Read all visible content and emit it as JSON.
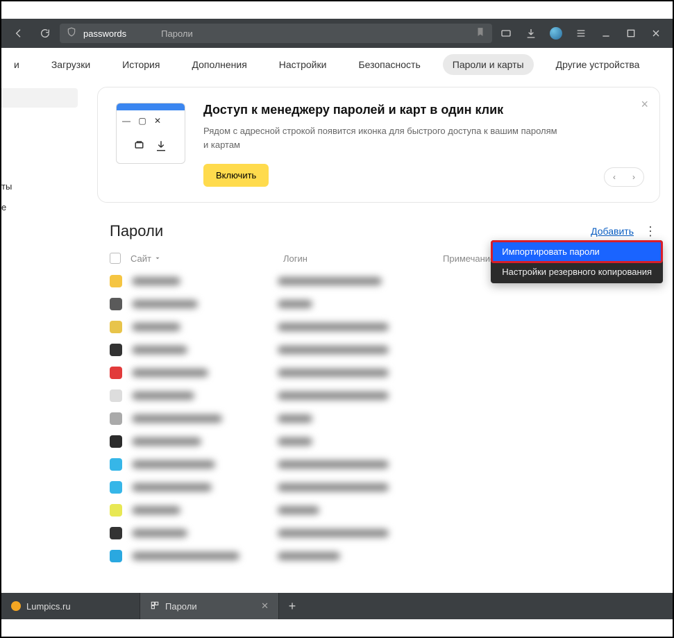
{
  "chrome": {
    "url_text": "passwords",
    "url_title": "Пароли"
  },
  "nav": {
    "items": [
      "и",
      "Загрузки",
      "История",
      "Дополнения",
      "Настройки",
      "Безопасность",
      "Пароли и карты",
      "Другие устройства"
    ],
    "active_index": 6
  },
  "sidebar": {
    "items": [
      "ты",
      "е"
    ]
  },
  "promo": {
    "title": "Доступ к менеджеру паролей и карт в один клик",
    "text": "Рядом с адресной строкой появится иконка для быстрого доступа к вашим паролям и картам",
    "button": "Включить"
  },
  "section": {
    "title": "Пароли",
    "add": "Добавить"
  },
  "dropdown": {
    "import": "Импортировать пароли",
    "backup": "Настройки резервного копирования"
  },
  "table": {
    "col_site": "Сайт",
    "col_login": "Логин",
    "col_note": "Примечание"
  },
  "tabs": {
    "t1": "Lumpics.ru",
    "t2": "Пароли"
  }
}
